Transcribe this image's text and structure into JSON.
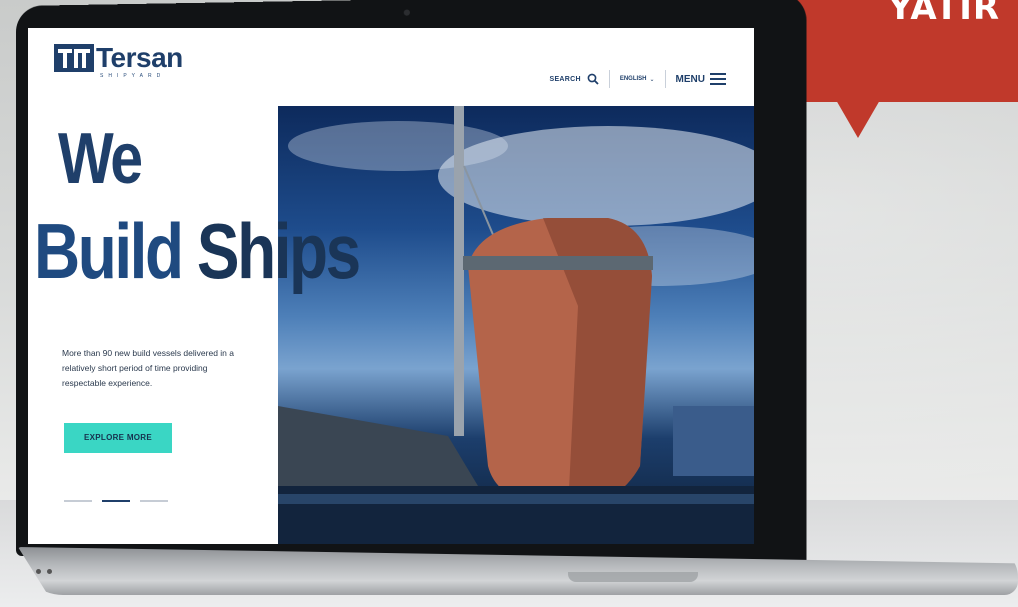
{
  "banner": {
    "text": "YATIR",
    "color": "#c0392b"
  },
  "site": {
    "logo_name": "Tersan",
    "logo_sub": "SHIPYARD",
    "brand_color": "#1f3f6a",
    "accent_color": "#3ad6c4"
  },
  "nav": {
    "search_label": "SEARCH",
    "language": "ENGLISH",
    "menu_label": "MENU",
    "icons": [
      "search-icon",
      "chevron-down-icon",
      "hamburger-icon"
    ]
  },
  "hero": {
    "title_line1": "We",
    "title_line2_a": "Build ",
    "title_line2_b": "Ships",
    "copy": "More than 90 new build vessels delivered in a relatively short period of time providing respectable experience.",
    "cta_label": "EXPLORE MORE",
    "slides_total": 3,
    "active_slide": 2
  }
}
